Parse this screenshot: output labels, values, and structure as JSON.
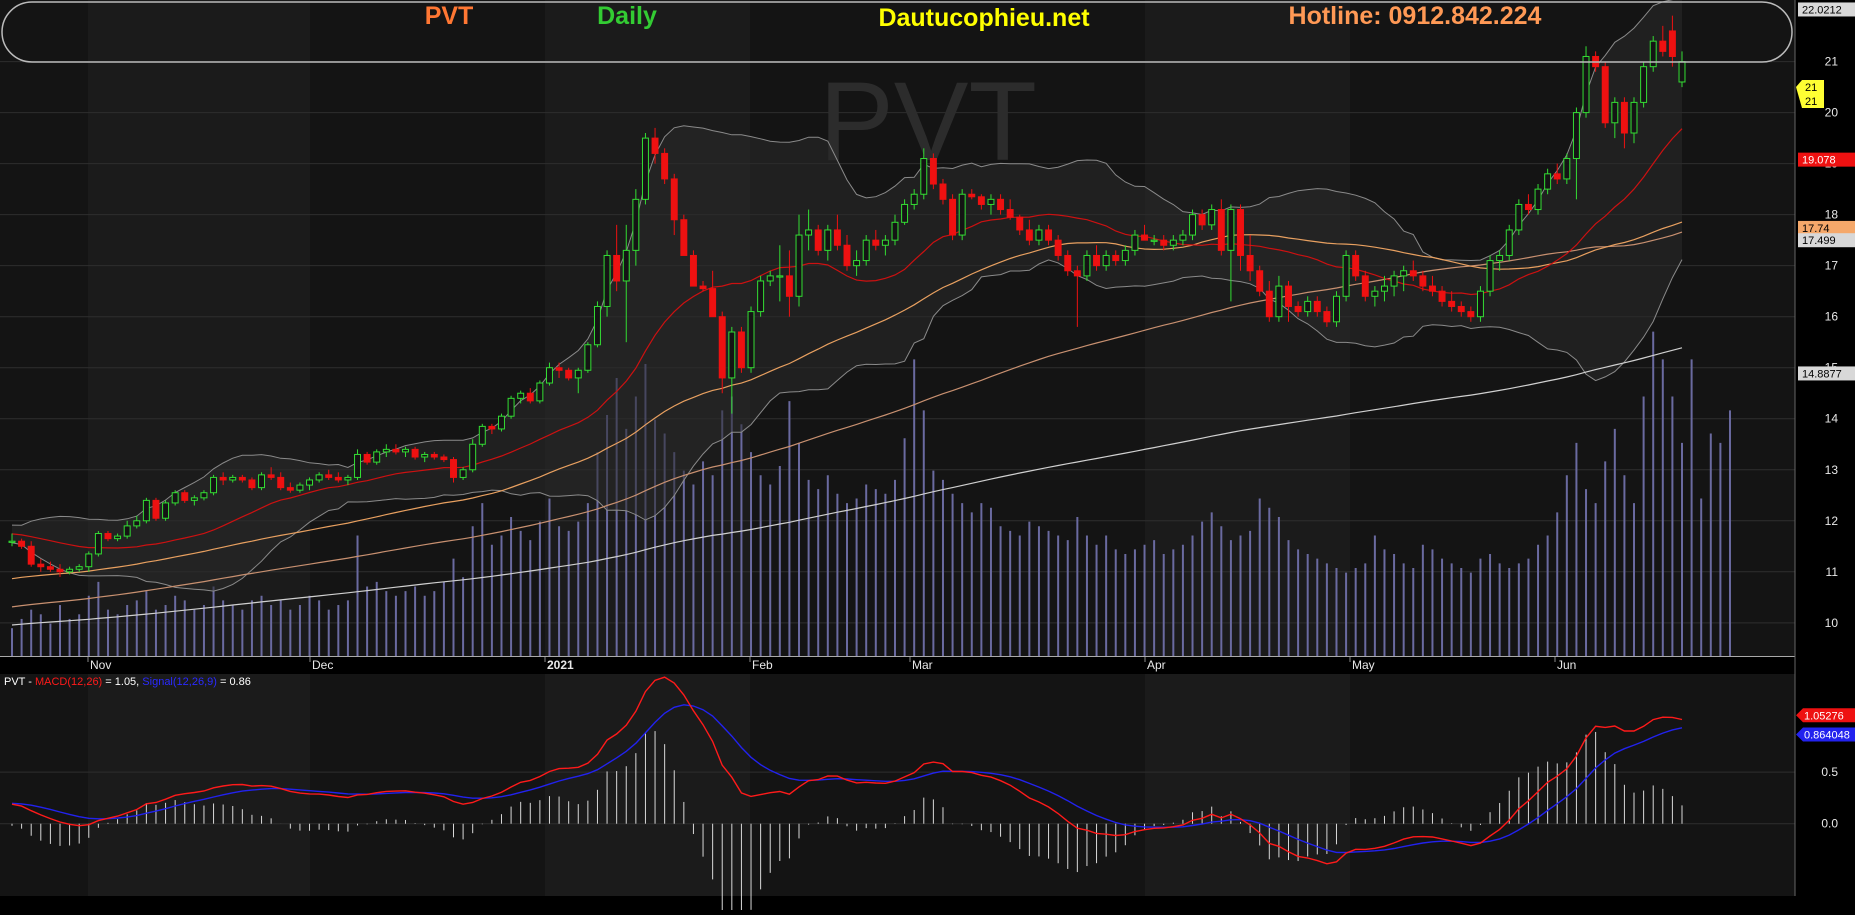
{
  "header": {
    "ticker": "PVT",
    "timeframe": "Daily",
    "site": "Dautucophieu.net",
    "hotline": "Hotline: 0912.842.224"
  },
  "watermark": "PVT",
  "colors": {
    "background": "#000000",
    "panel": "#141414",
    "up_candle": "#33dd33",
    "down_candle": "#ee1111",
    "ma20": "#cc1111",
    "ma50": "#e8a060",
    "ma100": "#c89070",
    "ma200": "#d0d0d0",
    "bollinger": "#8a8a8a",
    "volume": "#6a6aa0",
    "macd": "#ff1a1a",
    "signal": "#2222ee",
    "ticker": "#ff7733",
    "timeframe": "#33cc33",
    "site": "#ffff00",
    "hotline": "#ff9955"
  },
  "chart_data": [
    {
      "type": "candlestick",
      "title": "PVT",
      "x_labels": [
        "Nov",
        "Dec",
        "2021",
        "Feb",
        "Mar",
        "Apr",
        "May",
        "Jun"
      ],
      "y_ticks": [
        10,
        11,
        12,
        13,
        14,
        15,
        16,
        17,
        18,
        19,
        20,
        21
      ],
      "ylim": [
        9.35,
        22.05
      ],
      "candles": [
        [
          11.6,
          11.75,
          11.5,
          11.6
        ],
        [
          11.6,
          11.65,
          11.45,
          11.5
        ],
        [
          11.5,
          11.6,
          11.1,
          11.15
        ],
        [
          11.15,
          11.25,
          11.0,
          11.1
        ],
        [
          11.1,
          11.2,
          11.0,
          11.05
        ],
        [
          11.05,
          11.15,
          10.9,
          11.0
        ],
        [
          11.0,
          11.1,
          10.95,
          11.05
        ],
        [
          11.05,
          11.15,
          11.0,
          11.1
        ],
        [
          11.1,
          11.4,
          11.0,
          11.35
        ],
        [
          11.35,
          11.8,
          11.3,
          11.75
        ],
        [
          11.75,
          11.8,
          11.6,
          11.65
        ],
        [
          11.65,
          11.75,
          11.6,
          11.7
        ],
        [
          11.7,
          12.0,
          11.65,
          11.9
        ],
        [
          11.9,
          12.1,
          11.85,
          12.0
        ],
        [
          12.0,
          12.45,
          11.95,
          12.4
        ],
        [
          12.4,
          12.45,
          12.0,
          12.05
        ],
        [
          12.05,
          12.4,
          12.0,
          12.35
        ],
        [
          12.35,
          12.6,
          12.3,
          12.55
        ],
        [
          12.55,
          12.6,
          12.35,
          12.4
        ],
        [
          12.4,
          12.5,
          12.3,
          12.45
        ],
        [
          12.45,
          12.6,
          12.4,
          12.55
        ],
        [
          12.55,
          12.9,
          12.5,
          12.85
        ],
        [
          12.85,
          12.95,
          12.7,
          12.8
        ],
        [
          12.8,
          12.9,
          12.75,
          12.85
        ],
        [
          12.85,
          12.9,
          12.75,
          12.8
        ],
        [
          12.8,
          12.85,
          12.6,
          12.65
        ],
        [
          12.65,
          12.95,
          12.6,
          12.9
        ],
        [
          12.9,
          13.05,
          12.8,
          12.85
        ],
        [
          12.85,
          12.95,
          12.6,
          12.65
        ],
        [
          12.65,
          12.75,
          12.55,
          12.6
        ],
        [
          12.6,
          12.75,
          12.55,
          12.7
        ],
        [
          12.7,
          12.85,
          12.6,
          12.8
        ],
        [
          12.8,
          12.95,
          12.75,
          12.9
        ],
        [
          12.9,
          13.0,
          12.8,
          12.85
        ],
        [
          12.85,
          12.95,
          12.75,
          12.8
        ],
        [
          12.8,
          12.9,
          12.7,
          12.85
        ],
        [
          12.85,
          13.4,
          12.8,
          13.3
        ],
        [
          13.3,
          13.35,
          13.1,
          13.15
        ],
        [
          13.15,
          13.4,
          13.1,
          13.35
        ],
        [
          13.35,
          13.5,
          13.25,
          13.4
        ],
        [
          13.4,
          13.5,
          13.3,
          13.35
        ],
        [
          13.35,
          13.45,
          13.25,
          13.4
        ],
        [
          13.4,
          13.45,
          13.2,
          13.25
        ],
        [
          13.25,
          13.35,
          13.15,
          13.3
        ],
        [
          13.3,
          13.35,
          13.2,
          13.25
        ],
        [
          13.25,
          13.3,
          13.15,
          13.2
        ],
        [
          13.2,
          13.25,
          12.75,
          12.85
        ],
        [
          12.85,
          13.05,
          12.8,
          13.0
        ],
        [
          13.0,
          13.6,
          12.95,
          13.5
        ],
        [
          13.5,
          13.9,
          13.45,
          13.85
        ],
        [
          13.85,
          13.9,
          13.7,
          13.8
        ],
        [
          13.8,
          14.1,
          13.75,
          14.05
        ],
        [
          14.05,
          14.45,
          14.0,
          14.4
        ],
        [
          14.4,
          14.55,
          14.3,
          14.5
        ],
        [
          14.5,
          14.6,
          14.3,
          14.35
        ],
        [
          14.35,
          14.75,
          14.3,
          14.7
        ],
        [
          14.7,
          15.1,
          14.65,
          15.0
        ],
        [
          15.0,
          15.1,
          14.8,
          14.95
        ],
        [
          14.95,
          15.0,
          14.75,
          14.8
        ],
        [
          14.8,
          15.0,
          14.5,
          14.95
        ],
        [
          14.95,
          15.5,
          14.9,
          15.45
        ],
        [
          15.45,
          16.3,
          15.4,
          16.2
        ],
        [
          16.2,
          17.3,
          16.0,
          17.2
        ],
        [
          17.2,
          17.8,
          16.5,
          16.7
        ],
        [
          16.7,
          17.8,
          15.5,
          17.3
        ],
        [
          17.3,
          18.5,
          17.0,
          18.3
        ],
        [
          18.3,
          19.6,
          18.2,
          19.5
        ],
        [
          19.5,
          19.7,
          19.0,
          19.2
        ],
        [
          19.2,
          19.3,
          18.6,
          18.7
        ],
        [
          18.7,
          18.8,
          17.6,
          17.9
        ],
        [
          17.9,
          18.0,
          17.2,
          17.2
        ],
        [
          17.2,
          17.3,
          16.6,
          16.6
        ],
        [
          16.6,
          16.7,
          16.5,
          16.55
        ],
        [
          16.55,
          16.9,
          16.0,
          16.0
        ],
        [
          16.0,
          16.1,
          14.5,
          14.8
        ],
        [
          14.8,
          15.8,
          14.1,
          15.7
        ],
        [
          15.7,
          15.8,
          14.9,
          15.0
        ],
        [
          15.0,
          16.2,
          14.9,
          16.1
        ],
        [
          16.1,
          16.8,
          16.0,
          16.7
        ],
        [
          16.7,
          16.9,
          16.6,
          16.8
        ],
        [
          16.8,
          17.4,
          16.3,
          16.8
        ],
        [
          16.8,
          17.3,
          16.0,
          16.4
        ],
        [
          16.4,
          18.0,
          16.2,
          17.6
        ],
        [
          17.6,
          18.1,
          17.3,
          17.7
        ],
        [
          17.7,
          17.8,
          17.2,
          17.3
        ],
        [
          17.3,
          17.8,
          17.1,
          17.7
        ],
        [
          17.7,
          18.0,
          17.3,
          17.4
        ],
        [
          17.4,
          17.6,
          16.9,
          17.0
        ],
        [
          17.0,
          17.3,
          16.8,
          17.1
        ],
        [
          17.1,
          17.6,
          17.0,
          17.5
        ],
        [
          17.5,
          17.7,
          17.3,
          17.4
        ],
        [
          17.4,
          17.6,
          17.2,
          17.5
        ],
        [
          17.5,
          18.0,
          17.4,
          17.85
        ],
        [
          17.85,
          18.3,
          17.8,
          18.2
        ],
        [
          18.2,
          18.5,
          18.1,
          18.4
        ],
        [
          18.4,
          19.3,
          18.3,
          19.1
        ],
        [
          19.1,
          19.2,
          18.5,
          18.6
        ],
        [
          18.6,
          18.7,
          18.2,
          18.3
        ],
        [
          18.3,
          18.4,
          17.5,
          17.6
        ],
        [
          17.6,
          18.5,
          17.5,
          18.4
        ],
        [
          18.4,
          18.5,
          18.3,
          18.35
        ],
        [
          18.35,
          18.4,
          18.1,
          18.2
        ],
        [
          18.2,
          18.4,
          18.0,
          18.3
        ],
        [
          18.3,
          18.4,
          18.0,
          18.1
        ],
        [
          18.1,
          18.3,
          17.9,
          17.95
        ],
        [
          17.95,
          18.0,
          17.6,
          17.7
        ],
        [
          17.7,
          17.9,
          17.4,
          17.5
        ],
        [
          17.5,
          17.8,
          17.4,
          17.7
        ],
        [
          17.7,
          17.8,
          17.4,
          17.5
        ],
        [
          17.5,
          17.6,
          17.1,
          17.2
        ],
        [
          17.2,
          17.3,
          16.8,
          16.9
        ],
        [
          16.9,
          17.0,
          15.8,
          16.8
        ],
        [
          16.8,
          17.3,
          16.7,
          17.2
        ],
        [
          17.2,
          17.4,
          16.9,
          17.0
        ],
        [
          17.0,
          17.3,
          16.9,
          17.2
        ],
        [
          17.2,
          17.3,
          17.0,
          17.1
        ],
        [
          17.1,
          17.4,
          17.0,
          17.3
        ],
        [
          17.3,
          17.7,
          17.2,
          17.6
        ],
        [
          17.6,
          17.8,
          17.5,
          17.5
        ],
        [
          17.5,
          17.6,
          17.4,
          17.5
        ],
        [
          17.5,
          17.6,
          17.3,
          17.4
        ],
        [
          17.4,
          17.6,
          17.3,
          17.5
        ],
        [
          17.5,
          17.7,
          17.4,
          17.6
        ],
        [
          17.6,
          18.1,
          17.5,
          18.0
        ],
        [
          18.0,
          18.1,
          17.7,
          17.8
        ],
        [
          17.8,
          18.2,
          17.7,
          18.1
        ],
        [
          18.1,
          18.3,
          17.2,
          17.3
        ],
        [
          17.3,
          18.2,
          16.3,
          18.1
        ],
        [
          18.1,
          18.2,
          16.9,
          17.2
        ],
        [
          17.2,
          17.6,
          16.7,
          16.9
        ],
        [
          16.9,
          17.0,
          16.4,
          16.5
        ],
        [
          16.5,
          16.7,
          15.9,
          16.0
        ],
        [
          16.0,
          16.8,
          15.9,
          16.6
        ],
        [
          16.6,
          16.7,
          15.9,
          16.2
        ],
        [
          16.2,
          16.3,
          16.0,
          16.1
        ],
        [
          16.1,
          16.4,
          16.0,
          16.3
        ],
        [
          16.3,
          16.4,
          16.0,
          16.1
        ],
        [
          16.1,
          16.2,
          15.8,
          15.9
        ],
        [
          15.9,
          16.5,
          15.8,
          16.4
        ],
        [
          16.4,
          17.3,
          16.3,
          17.2
        ],
        [
          17.2,
          17.3,
          16.7,
          16.8
        ],
        [
          16.8,
          16.9,
          16.3,
          16.4
        ],
        [
          16.4,
          16.6,
          16.2,
          16.5
        ],
        [
          16.5,
          16.8,
          16.3,
          16.6
        ],
        [
          16.6,
          16.9,
          16.4,
          16.8
        ],
        [
          16.8,
          17.0,
          16.5,
          16.9
        ],
        [
          16.9,
          17.1,
          16.7,
          16.8
        ],
        [
          16.8,
          16.9,
          16.5,
          16.6
        ],
        [
          16.6,
          16.8,
          16.4,
          16.5
        ],
        [
          16.5,
          16.6,
          16.2,
          16.3
        ],
        [
          16.3,
          16.5,
          16.1,
          16.2
        ],
        [
          16.2,
          16.3,
          16.0,
          16.1
        ],
        [
          16.1,
          16.2,
          15.9,
          16.0
        ],
        [
          16.0,
          16.6,
          15.9,
          16.5
        ],
        [
          16.5,
          17.2,
          16.4,
          17.1
        ],
        [
          17.1,
          17.3,
          16.9,
          17.2
        ],
        [
          17.2,
          17.8,
          17.1,
          17.7
        ],
        [
          17.7,
          18.3,
          17.6,
          18.2
        ],
        [
          18.2,
          18.4,
          18.0,
          18.1
        ],
        [
          18.1,
          18.6,
          18.0,
          18.5
        ],
        [
          18.5,
          18.9,
          18.4,
          18.8
        ],
        [
          18.8,
          19.0,
          18.6,
          18.7
        ],
        [
          18.7,
          19.2,
          18.6,
          19.1
        ],
        [
          19.1,
          20.1,
          18.3,
          20.0
        ],
        [
          20.0,
          21.3,
          19.9,
          21.1
        ],
        [
          21.1,
          21.2,
          20.8,
          20.9
        ],
        [
          20.9,
          21.0,
          19.7,
          19.8
        ],
        [
          19.8,
          20.3,
          19.5,
          20.2
        ],
        [
          20.2,
          20.3,
          19.3,
          19.6
        ],
        [
          19.6,
          20.3,
          19.4,
          20.2
        ],
        [
          20.2,
          21.0,
          20.1,
          20.9
        ],
        [
          20.9,
          21.5,
          20.8,
          21.4
        ],
        [
          21.4,
          21.7,
          21.1,
          21.2
        ],
        [
          21.6,
          21.9,
          20.9,
          21.1
        ],
        [
          20.6,
          21.2,
          20.5,
          21.0
        ]
      ],
      "volume": [
        0.6,
        0.8,
        1.0,
        0.9,
        0.7,
        1.1,
        0.8,
        0.9,
        1.3,
        1.6,
        1.0,
        0.9,
        1.1,
        1.2,
        1.4,
        1.0,
        1.1,
        1.3,
        1.2,
        1.0,
        1.1,
        1.5,
        1.2,
        1.1,
        1.0,
        1.2,
        1.3,
        1.1,
        1.2,
        1.0,
        1.1,
        1.3,
        1.2,
        1.0,
        1.1,
        1.2,
        2.6,
        1.5,
        1.6,
        1.4,
        1.3,
        1.4,
        1.5,
        1.3,
        1.4,
        1.6,
        2.1,
        1.7,
        2.8,
        3.3,
        2.4,
        2.6,
        3.0,
        2.7,
        2.5,
        2.9,
        3.4,
        2.8,
        2.7,
        2.9,
        3.3,
        4.4,
        5.2,
        6.0,
        4.9,
        5.6,
        6.3,
        5.1,
        4.8,
        4.4,
        4.0,
        3.7,
        4.2,
        3.9,
        5.3,
        5.6,
        5.0,
        4.4,
        3.9,
        3.7,
        4.1,
        5.5,
        4.6,
        3.8,
        3.6,
        3.9,
        3.5,
        3.3,
        3.4,
        3.7,
        3.6,
        3.5,
        3.8,
        4.7,
        6.4,
        5.3,
        4.0,
        3.8,
        3.5,
        3.3,
        3.1,
        3.3,
        3.2,
        2.8,
        2.7,
        2.6,
        2.9,
        2.8,
        2.7,
        2.6,
        2.5,
        3.0,
        2.6,
        2.4,
        2.6,
        2.3,
        2.2,
        2.3,
        2.4,
        2.5,
        2.2,
        2.3,
        2.4,
        2.6,
        2.9,
        3.1,
        2.8,
        2.5,
        2.6,
        2.7,
        3.4,
        3.2,
        3.0,
        2.5,
        2.3,
        2.2,
        2.1,
        2.0,
        1.9,
        1.8,
        1.9,
        2.0,
        2.6,
        2.3,
        2.2,
        2.0,
        1.9,
        2.4,
        2.3,
        2.1,
        2.0,
        1.9,
        1.8,
        2.1,
        2.2,
        2.0,
        1.9,
        2.0,
        2.1,
        2.4,
        2.6,
        3.1,
        3.9,
        4.6,
        3.6,
        3.3,
        4.2,
        4.9,
        3.9,
        3.3,
        5.6,
        7.0,
        6.4,
        5.6,
        4.6,
        6.4,
        3.4,
        4.8,
        4.6,
        5.3
      ],
      "overlays": [
        {
          "name": "MA20",
          "last": 19.078
        },
        {
          "name": "MA50",
          "last": 17.74
        },
        {
          "name": "MA100",
          "last": 17.499
        },
        {
          "name": "MA200",
          "last": 14.8877
        }
      ],
      "right_tags": {
        "high": "22.0212",
        "close1": "21",
        "close2": "21",
        "ma20": "19.078",
        "ma50": "17.74",
        "ma100": "17.499",
        "ma200": "14.8877"
      }
    },
    {
      "type": "line",
      "title_prefix": "PVT - ",
      "macd_label": "MACD(12,26)",
      "macd_value": " = 1.05, ",
      "signal_label": "Signal(12,26,9)",
      "signal_value": " = 0.86",
      "y_ticks": [
        0.0,
        0.5
      ],
      "ylim": [
        -0.7,
        1.45
      ],
      "series": [
        {
          "name": "MACD(12,26)",
          "last": 1.05276
        },
        {
          "name": "Signal(12,26,9)",
          "last": 0.864048
        }
      ],
      "tags": {
        "macd": "1.05276",
        "signal": "0.864048"
      }
    }
  ]
}
